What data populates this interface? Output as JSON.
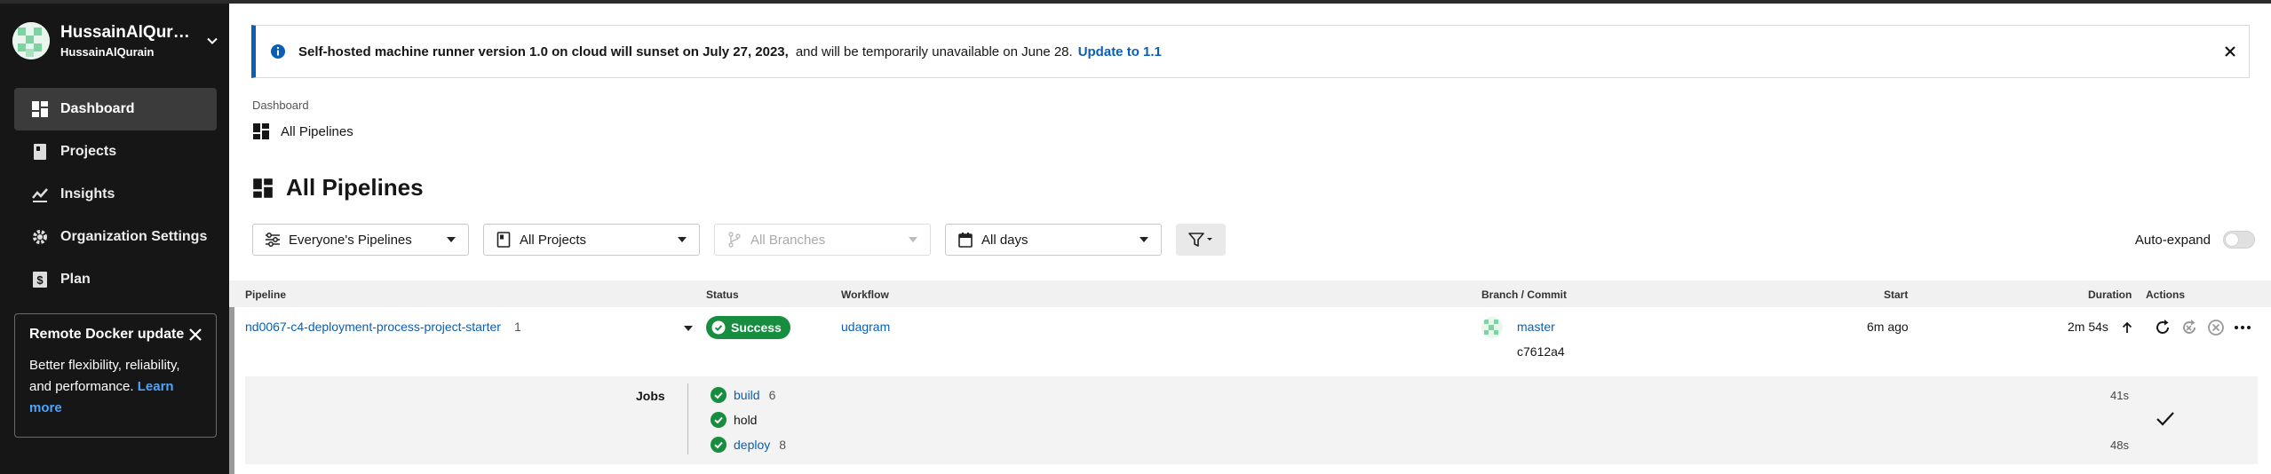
{
  "org": {
    "name": "HussainAlQurain",
    "sub": "HussainAlQurain"
  },
  "nav": [
    {
      "label": "Dashboard",
      "icon": "dashboard-icon",
      "active": true
    },
    {
      "label": "Projects",
      "icon": "book-icon"
    },
    {
      "label": "Insights",
      "icon": "insights-icon"
    },
    {
      "label": "Organization Settings",
      "icon": "gear-icon"
    },
    {
      "label": "Plan",
      "icon": "dollar-icon"
    }
  ],
  "promo": {
    "title": "Remote Docker update",
    "body": "Better flexibility, reliability, and performance.",
    "link": "Learn more"
  },
  "banner": {
    "bold": "Self-hosted machine runner version 1.0 on cloud will sunset on July 27, 2023,",
    "text": "and will be temporarily unavailable on June 28.",
    "link": "Update to 1.1"
  },
  "breadcrumb": {
    "root": "Dashboard",
    "current": "All Pipelines"
  },
  "page_title": "All Pipelines",
  "filters": {
    "pipelines": "Everyone's Pipelines",
    "projects": "All Projects",
    "branches": "All Branches",
    "days": "All days"
  },
  "autoexpand": "Auto-expand",
  "table": {
    "headers": {
      "pipeline": "Pipeline",
      "status": "Status",
      "workflow": "Workflow",
      "branch": "Branch / Commit",
      "start": "Start",
      "duration": "Duration",
      "actions": "Actions"
    },
    "row": {
      "pipeline": "nd0067-c4-deployment-process-project-starter",
      "number": "1",
      "status": "Success",
      "workflow": "udagram",
      "branch": "master",
      "commit": "c7612a4",
      "start": "6m ago",
      "duration": "2m 54s"
    }
  },
  "jobs": {
    "label": "Jobs",
    "items": [
      {
        "name": "build",
        "num": "6",
        "duration": "41s",
        "link": true
      },
      {
        "name": "hold",
        "num": "",
        "duration": "",
        "link": false
      },
      {
        "name": "deploy",
        "num": "8",
        "duration": "48s",
        "link": true
      }
    ]
  },
  "colors": {
    "success": "#168d3f",
    "link": "#0a5fb4",
    "sidebar": "#161616"
  }
}
